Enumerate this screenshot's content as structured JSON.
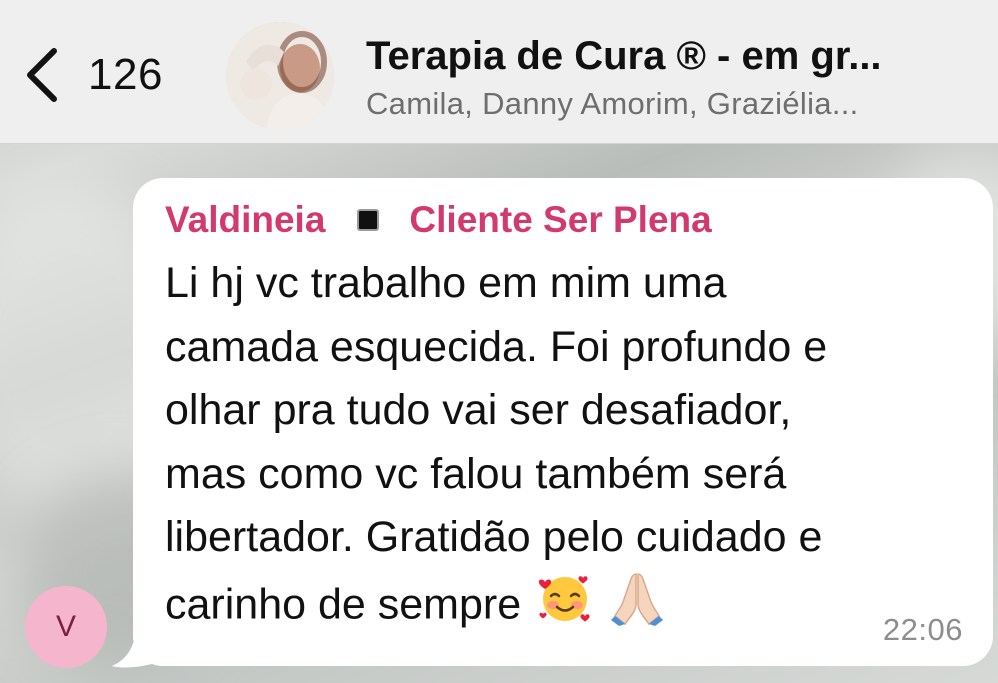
{
  "header": {
    "back_count": "126",
    "title": "Terapia de Cura ® - em gr...",
    "subtitle": "Camila, Danny Amorim, Graziélia..."
  },
  "message": {
    "sender_name": "Valdineia",
    "sender_tag": "Cliente Ser Plena",
    "lines": [
      "Li hj vc trabalho em mim uma",
      "camada esquecida. Foi profundo e",
      "olhar pra tudo vai ser desafiador,",
      "mas como vc falou também será",
      "libertador. Gratidão pelo cuidado e",
      "carinho de sempre"
    ],
    "emojis": [
      "smiling-face-with-hearts-emoji",
      "folded-hands-emoji"
    ],
    "time": "22:06",
    "avatar_initial": "V"
  },
  "colors": {
    "header_bg": "#efefef",
    "sender_name": "#d23a6e",
    "avatar_bg": "#f5b6cd",
    "bubble_bg": "#ffffff"
  }
}
